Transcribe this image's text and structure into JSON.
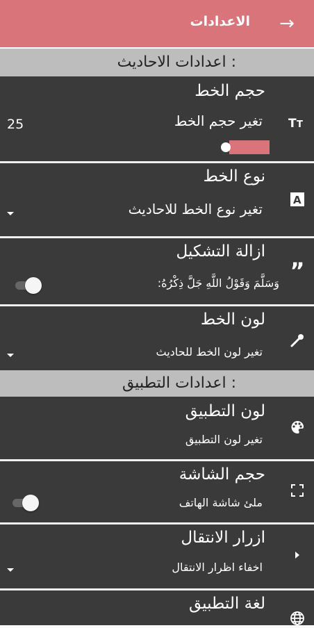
{
  "appbar": {
    "title": "الاعدادات",
    "back_icon": "arrow-right-icon"
  },
  "sections": {
    "hadith": {
      "label": "اعدادات الاحاديث :"
    },
    "app": {
      "label": "اعدادات التطبيق :"
    }
  },
  "rows": {
    "font_size": {
      "title": "حجم الخط",
      "subtitle": "تغير حجم الخط",
      "value": "25",
      "icon": "text-size-icon",
      "slider_level": 0
    },
    "font_type": {
      "title": "نوع الخط",
      "subtitle": "تغير نوع الخط للاحاديث",
      "icon": "font-icon"
    },
    "diacritics": {
      "title": "ازالة التشكيل",
      "subtitle": "وَسَلَّمَ وَقَوْلُ اللَّهِ جَلَّ ذِكْرُهُ:",
      "icon": "quote-icon",
      "toggle_on": false
    },
    "font_color": {
      "title": "لون الخط",
      "subtitle": "تغير لون الخط للحاديث",
      "icon": "eyedropper-icon"
    },
    "app_color": {
      "title": "لون التطبيق",
      "subtitle": "تغير لون التطبيق",
      "icon": "palette-icon"
    },
    "screen_size": {
      "title": "حجم الشاشة",
      "subtitle": "ملئ شاشة الهاتف",
      "icon": "fullscreen-icon",
      "toggle_on": false
    },
    "nav_buttons": {
      "title": "ازرار الانتقال",
      "subtitle": "اخفاء اظرار الانتقال",
      "icon": "play-small-icon"
    },
    "language": {
      "title": "لغة التطبيق",
      "icon": "globe-icon"
    }
  },
  "colors": {
    "accent": "#d9747a",
    "row_bg": "#3a3a3a",
    "section_bg": "#bdbdbd"
  }
}
